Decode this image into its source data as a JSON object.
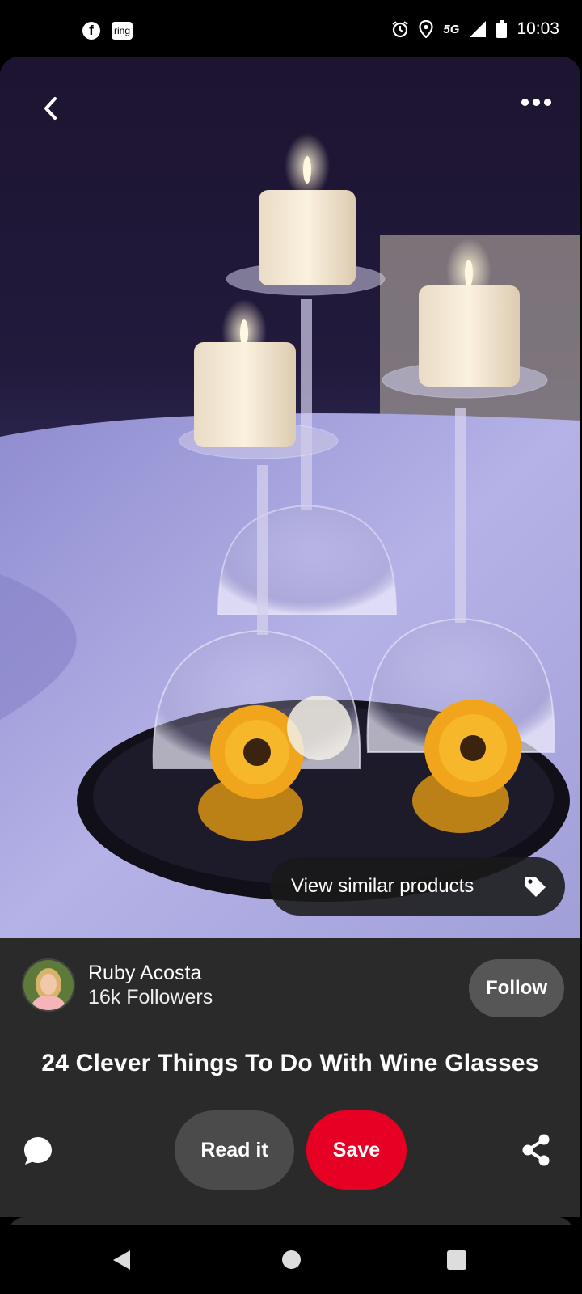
{
  "status_bar": {
    "time": "10:03",
    "network": "5G",
    "left_icons": [
      "facebook-icon",
      "ring-icon"
    ],
    "ring_label": "ring",
    "fb_label": "f",
    "right_icons": [
      "alarm-icon",
      "location-icon",
      "signal-icon",
      "battery-icon"
    ]
  },
  "pin": {
    "image_subject": "candles-on-wine-glasses",
    "view_similar_label": "View similar products",
    "creator": {
      "name": "Ruby Acosta",
      "followers": "16k Followers"
    },
    "follow_label": "Follow",
    "title": "24 Clever Things To Do With Wine Glasses",
    "read_label": "Read it",
    "save_label": "Save"
  },
  "colors": {
    "save": "#e60023",
    "card": "#2a2a2a",
    "read": "#4b4b4b",
    "follow": "#565656"
  }
}
